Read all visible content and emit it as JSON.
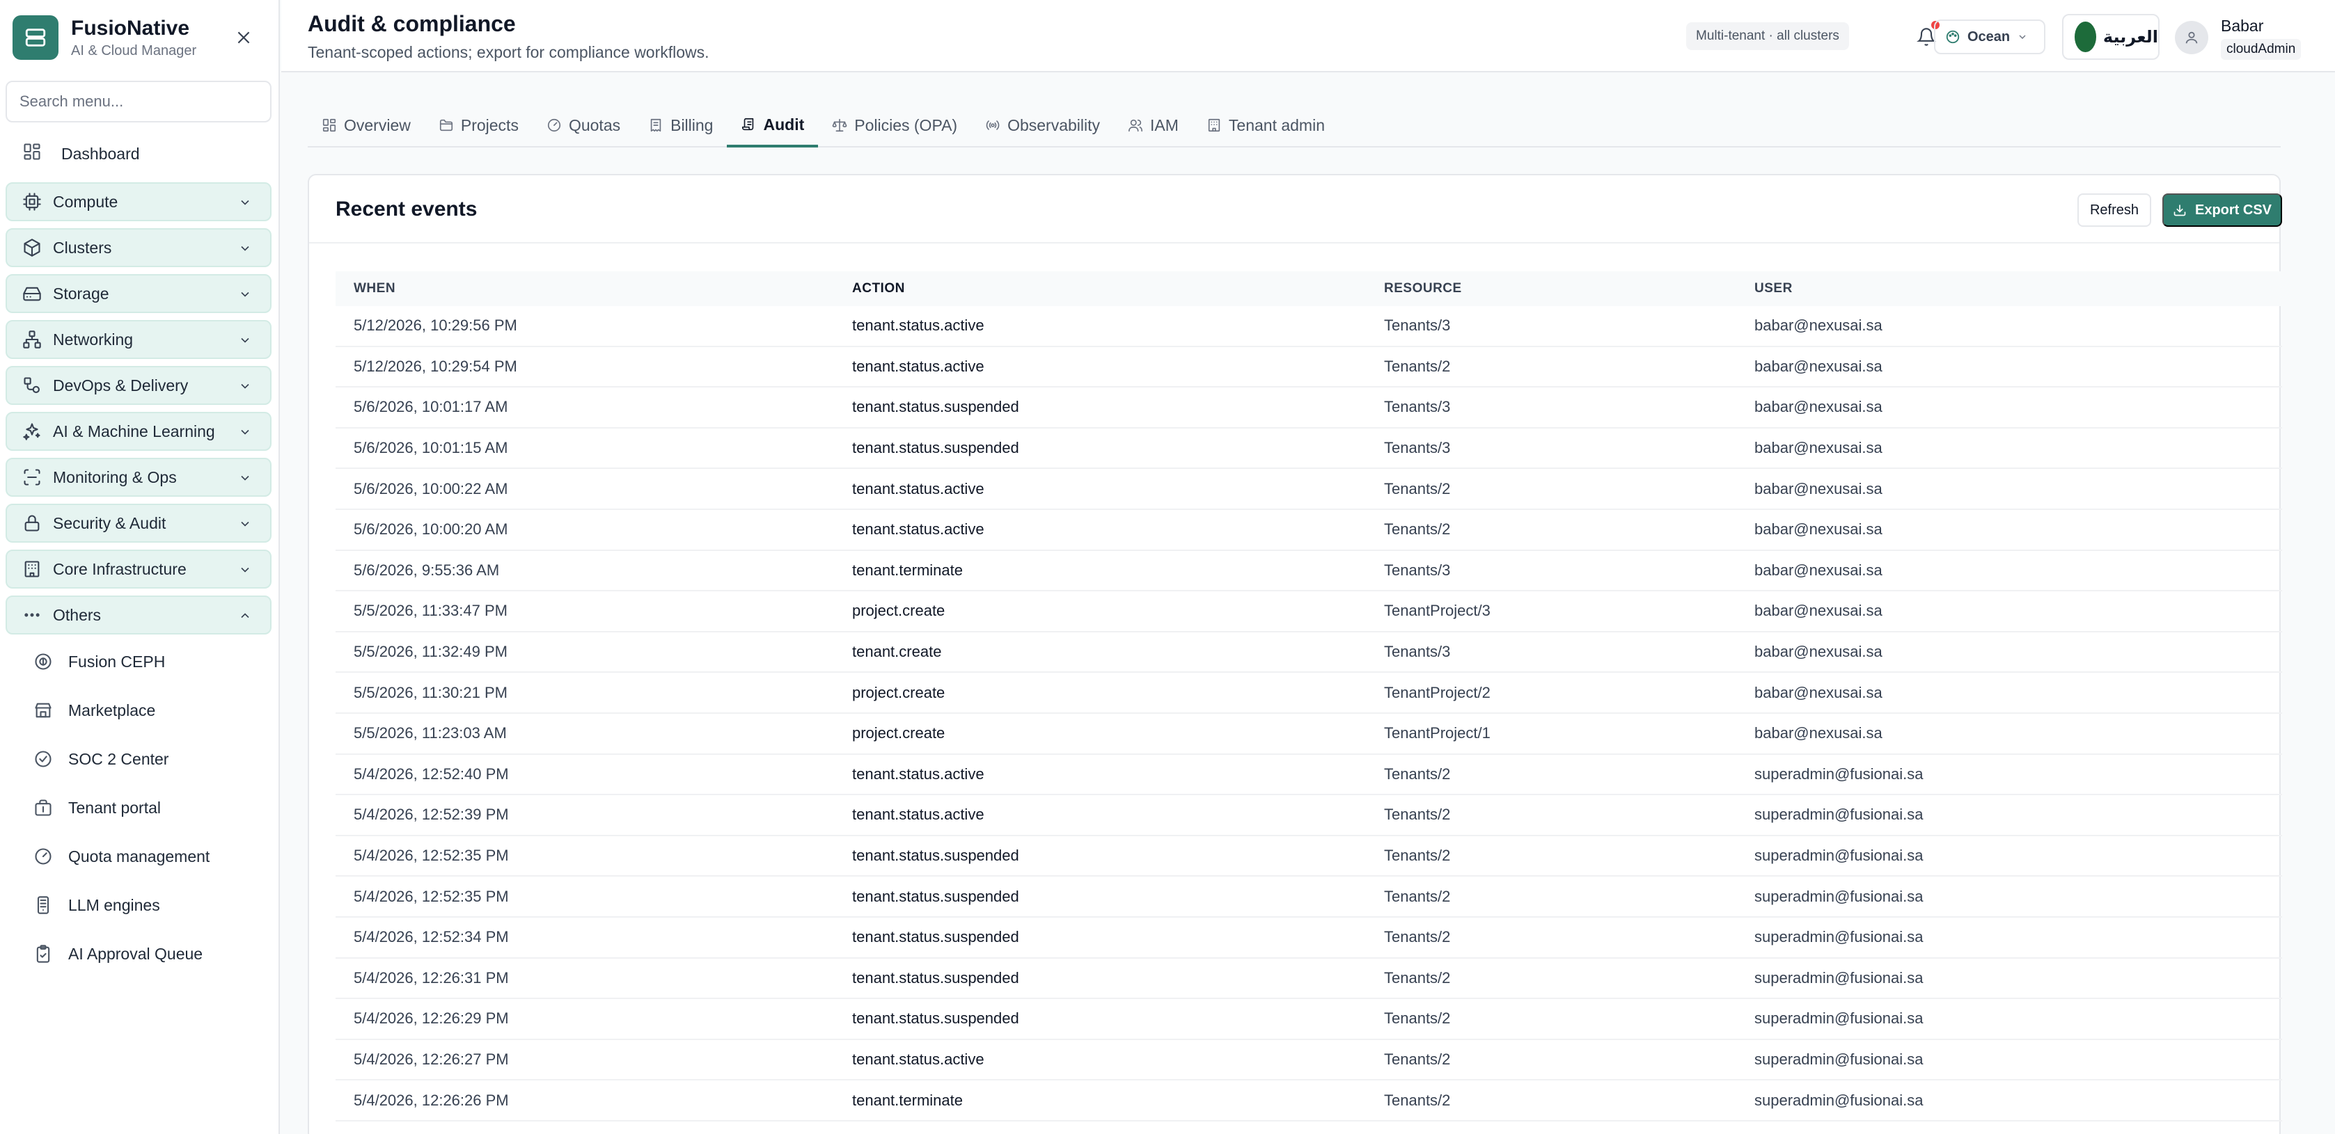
{
  "brand": {
    "name": "FusioNative",
    "subtitle": "AI & Cloud Manager"
  },
  "search": {
    "placeholder": "Search menu..."
  },
  "sidebar": {
    "dashboard": "Dashboard",
    "groups": [
      {
        "label": "Compute",
        "icon": "cpu-icon",
        "expanded": false
      },
      {
        "label": "Clusters",
        "icon": "cube-icon",
        "expanded": false
      },
      {
        "label": "Storage",
        "icon": "hard-drive-icon",
        "expanded": false
      },
      {
        "label": "Networking",
        "icon": "network-icon",
        "expanded": false
      },
      {
        "label": "DevOps & Delivery",
        "icon": "git-icon",
        "expanded": false
      },
      {
        "label": "AI & Machine Learning",
        "icon": "sparkles-icon",
        "expanded": false
      },
      {
        "label": "Monitoring & Ops",
        "icon": "monitor-icon",
        "expanded": false
      },
      {
        "label": "Security & Audit",
        "icon": "lock-icon",
        "expanded": false
      },
      {
        "label": "Core Infrastructure",
        "icon": "building-icon",
        "expanded": false
      },
      {
        "label": "Others",
        "icon": "more-icon",
        "expanded": true
      }
    ],
    "others_items": [
      {
        "label": "Fusion CEPH",
        "icon": "ceph-icon"
      },
      {
        "label": "Marketplace",
        "icon": "store-icon"
      },
      {
        "label": "SOC 2 Center",
        "icon": "check-circle-icon"
      },
      {
        "label": "Tenant portal",
        "icon": "briefcase-icon"
      },
      {
        "label": "Quota management",
        "icon": "gauge-icon"
      },
      {
        "label": "LLM engines",
        "icon": "server-icon"
      },
      {
        "label": "AI Approval Queue",
        "icon": "clipboard-check-icon"
      }
    ]
  },
  "header": {
    "title": "Audit & compliance",
    "subtitle": "Tenant-scoped actions; export for compliance workflows.",
    "scope": "Multi-tenant · all clusters",
    "theme": "Ocean",
    "language": "العربية",
    "user": {
      "name": "Babar",
      "role": "cloudAdmin"
    }
  },
  "tabs": [
    {
      "label": "Overview",
      "icon": "grid-icon",
      "active": false
    },
    {
      "label": "Projects",
      "icon": "folder-icon",
      "active": false
    },
    {
      "label": "Quotas",
      "icon": "gauge-icon",
      "active": false
    },
    {
      "label": "Billing",
      "icon": "receipt-icon",
      "active": false
    },
    {
      "label": "Audit",
      "icon": "scroll-icon",
      "active": true
    },
    {
      "label": "Policies (OPA)",
      "icon": "scale-icon",
      "active": false
    },
    {
      "label": "Observability",
      "icon": "radio-icon",
      "active": false
    },
    {
      "label": "IAM",
      "icon": "users-icon",
      "active": false
    },
    {
      "label": "Tenant admin",
      "icon": "building-icon",
      "active": false
    }
  ],
  "card": {
    "title": "Recent events",
    "refresh_label": "Refresh",
    "export_label": "Export CSV"
  },
  "table": {
    "columns": [
      "WHEN",
      "ACTION",
      "RESOURCE",
      "USER"
    ],
    "rows": [
      [
        "5/12/2026, 10:29:56 PM",
        "tenant.status.active",
        "Tenants/3",
        "babar@nexusai.sa"
      ],
      [
        "5/12/2026, 10:29:54 PM",
        "tenant.status.active",
        "Tenants/2",
        "babar@nexusai.sa"
      ],
      [
        "5/6/2026, 10:01:17 AM",
        "tenant.status.suspended",
        "Tenants/3",
        "babar@nexusai.sa"
      ],
      [
        "5/6/2026, 10:01:15 AM",
        "tenant.status.suspended",
        "Tenants/3",
        "babar@nexusai.sa"
      ],
      [
        "5/6/2026, 10:00:22 AM",
        "tenant.status.active",
        "Tenants/2",
        "babar@nexusai.sa"
      ],
      [
        "5/6/2026, 10:00:20 AM",
        "tenant.status.active",
        "Tenants/2",
        "babar@nexusai.sa"
      ],
      [
        "5/6/2026, 9:55:36 AM",
        "tenant.terminate",
        "Tenants/3",
        "babar@nexusai.sa"
      ],
      [
        "5/5/2026, 11:33:47 PM",
        "project.create",
        "TenantProject/3",
        "babar@nexusai.sa"
      ],
      [
        "5/5/2026, 11:32:49 PM",
        "tenant.create",
        "Tenants/3",
        "babar@nexusai.sa"
      ],
      [
        "5/5/2026, 11:30:21 PM",
        "project.create",
        "TenantProject/2",
        "babar@nexusai.sa"
      ],
      [
        "5/5/2026, 11:23:03 AM",
        "project.create",
        "TenantProject/1",
        "babar@nexusai.sa"
      ],
      [
        "5/4/2026, 12:52:40 PM",
        "tenant.status.active",
        "Tenants/2",
        "superadmin@fusionai.sa"
      ],
      [
        "5/4/2026, 12:52:39 PM",
        "tenant.status.active",
        "Tenants/2",
        "superadmin@fusionai.sa"
      ],
      [
        "5/4/2026, 12:52:35 PM",
        "tenant.status.suspended",
        "Tenants/2",
        "superadmin@fusionai.sa"
      ],
      [
        "5/4/2026, 12:52:35 PM",
        "tenant.status.suspended",
        "Tenants/2",
        "superadmin@fusionai.sa"
      ],
      [
        "5/4/2026, 12:52:34 PM",
        "tenant.status.suspended",
        "Tenants/2",
        "superadmin@fusionai.sa"
      ],
      [
        "5/4/2026, 12:26:31 PM",
        "tenant.status.suspended",
        "Tenants/2",
        "superadmin@fusionai.sa"
      ],
      [
        "5/4/2026, 12:26:29 PM",
        "tenant.status.suspended",
        "Tenants/2",
        "superadmin@fusionai.sa"
      ],
      [
        "5/4/2026, 12:26:27 PM",
        "tenant.status.active",
        "Tenants/2",
        "superadmin@fusionai.sa"
      ],
      [
        "5/4/2026, 12:26:26 PM",
        "tenant.terminate",
        "Tenants/2",
        "superadmin@fusionai.sa"
      ]
    ]
  },
  "colors": {
    "accent": "#2f7d6f",
    "group_bg": "#e6f4f1",
    "notification": "#ef4444"
  }
}
